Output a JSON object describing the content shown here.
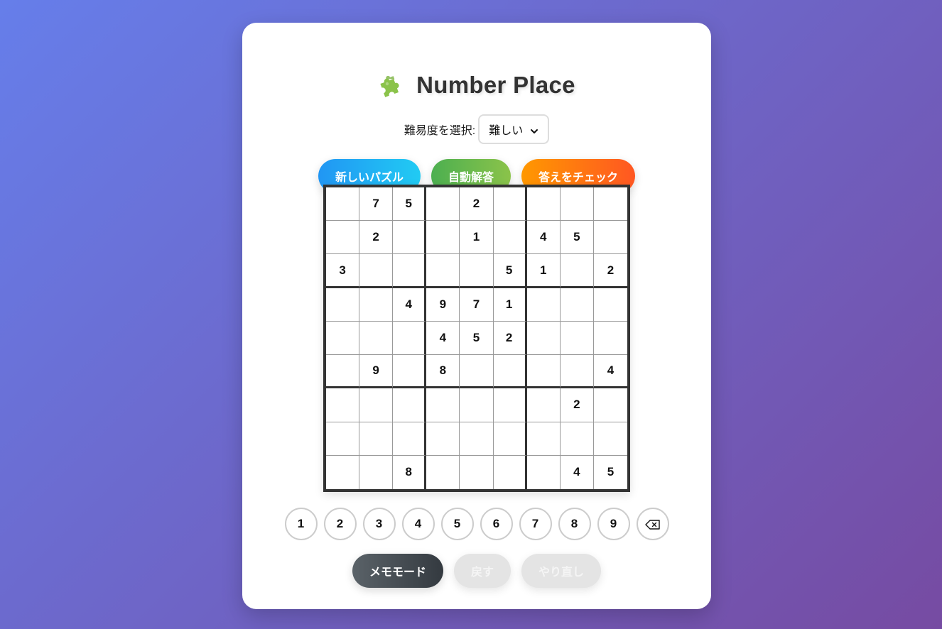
{
  "header": {
    "title": "Number Place",
    "icon": "puzzle-piece-icon"
  },
  "difficulty": {
    "label": "難易度を選択:",
    "selected": "難しい"
  },
  "actions": {
    "new_puzzle": "新しいパズル",
    "auto_solve": "自動解答",
    "check_answer": "答えをチェック"
  },
  "board": {
    "rows": [
      [
        "",
        "7",
        "5",
        "",
        "2",
        "",
        "",
        "",
        ""
      ],
      [
        "",
        "2",
        "",
        "",
        "1",
        "",
        "4",
        "5",
        ""
      ],
      [
        "3",
        "",
        "",
        "",
        "",
        "5",
        "1",
        "",
        "2"
      ],
      [
        "",
        "",
        "4",
        "9",
        "7",
        "1",
        "",
        "",
        ""
      ],
      [
        "",
        "",
        "",
        "4",
        "5",
        "2",
        "",
        "",
        ""
      ],
      [
        "",
        "9",
        "",
        "8",
        "",
        "",
        "",
        "",
        "4"
      ],
      [
        "",
        "",
        "",
        "",
        "",
        "",
        "",
        "2",
        ""
      ],
      [
        "",
        "",
        "",
        "",
        "",
        "",
        "",
        "",
        ""
      ],
      [
        "",
        "",
        "8",
        "",
        "",
        "",
        "",
        "4",
        "5"
      ]
    ]
  },
  "number_pad": {
    "digits": [
      "1",
      "2",
      "3",
      "4",
      "5",
      "6",
      "7",
      "8",
      "9"
    ],
    "erase_icon": "backspace-icon"
  },
  "controls": {
    "memo_mode": "メモモード",
    "undo": "戻す",
    "redo": "やり直し"
  },
  "colors": {
    "background_start": "#667eea",
    "background_end": "#764ba2",
    "new_puzzle": "#2196f3",
    "auto_solve": "#4caf50",
    "check_answer": "#ff9800",
    "memo_mode": "#495057",
    "disabled": "#e4e4e4"
  }
}
